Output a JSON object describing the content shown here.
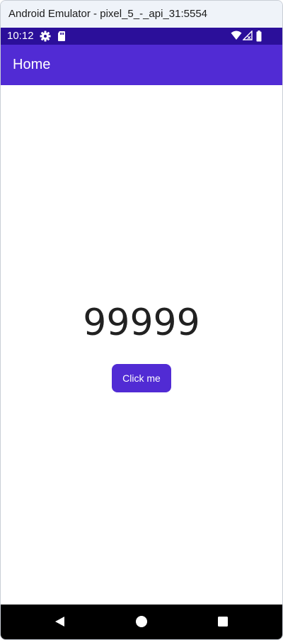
{
  "window": {
    "title": "Android Emulator - pixel_5_-_api_31:5554"
  },
  "status_bar": {
    "time": "10:12",
    "left_icons": [
      "gear-icon",
      "sd-card-icon"
    ],
    "right_icons": [
      "wifi-icon",
      "signal-icon",
      "battery-icon"
    ]
  },
  "app_bar": {
    "title": "Home"
  },
  "main": {
    "counter": "99999",
    "button_label": "Click me"
  },
  "nav_bar": {
    "buttons": [
      "back-icon",
      "home-icon",
      "recents-icon"
    ]
  },
  "colors": {
    "status_bar": "#2b0f9a",
    "app_bar": "#512bd4",
    "button": "#512bd4",
    "nav_bar": "#000000"
  }
}
